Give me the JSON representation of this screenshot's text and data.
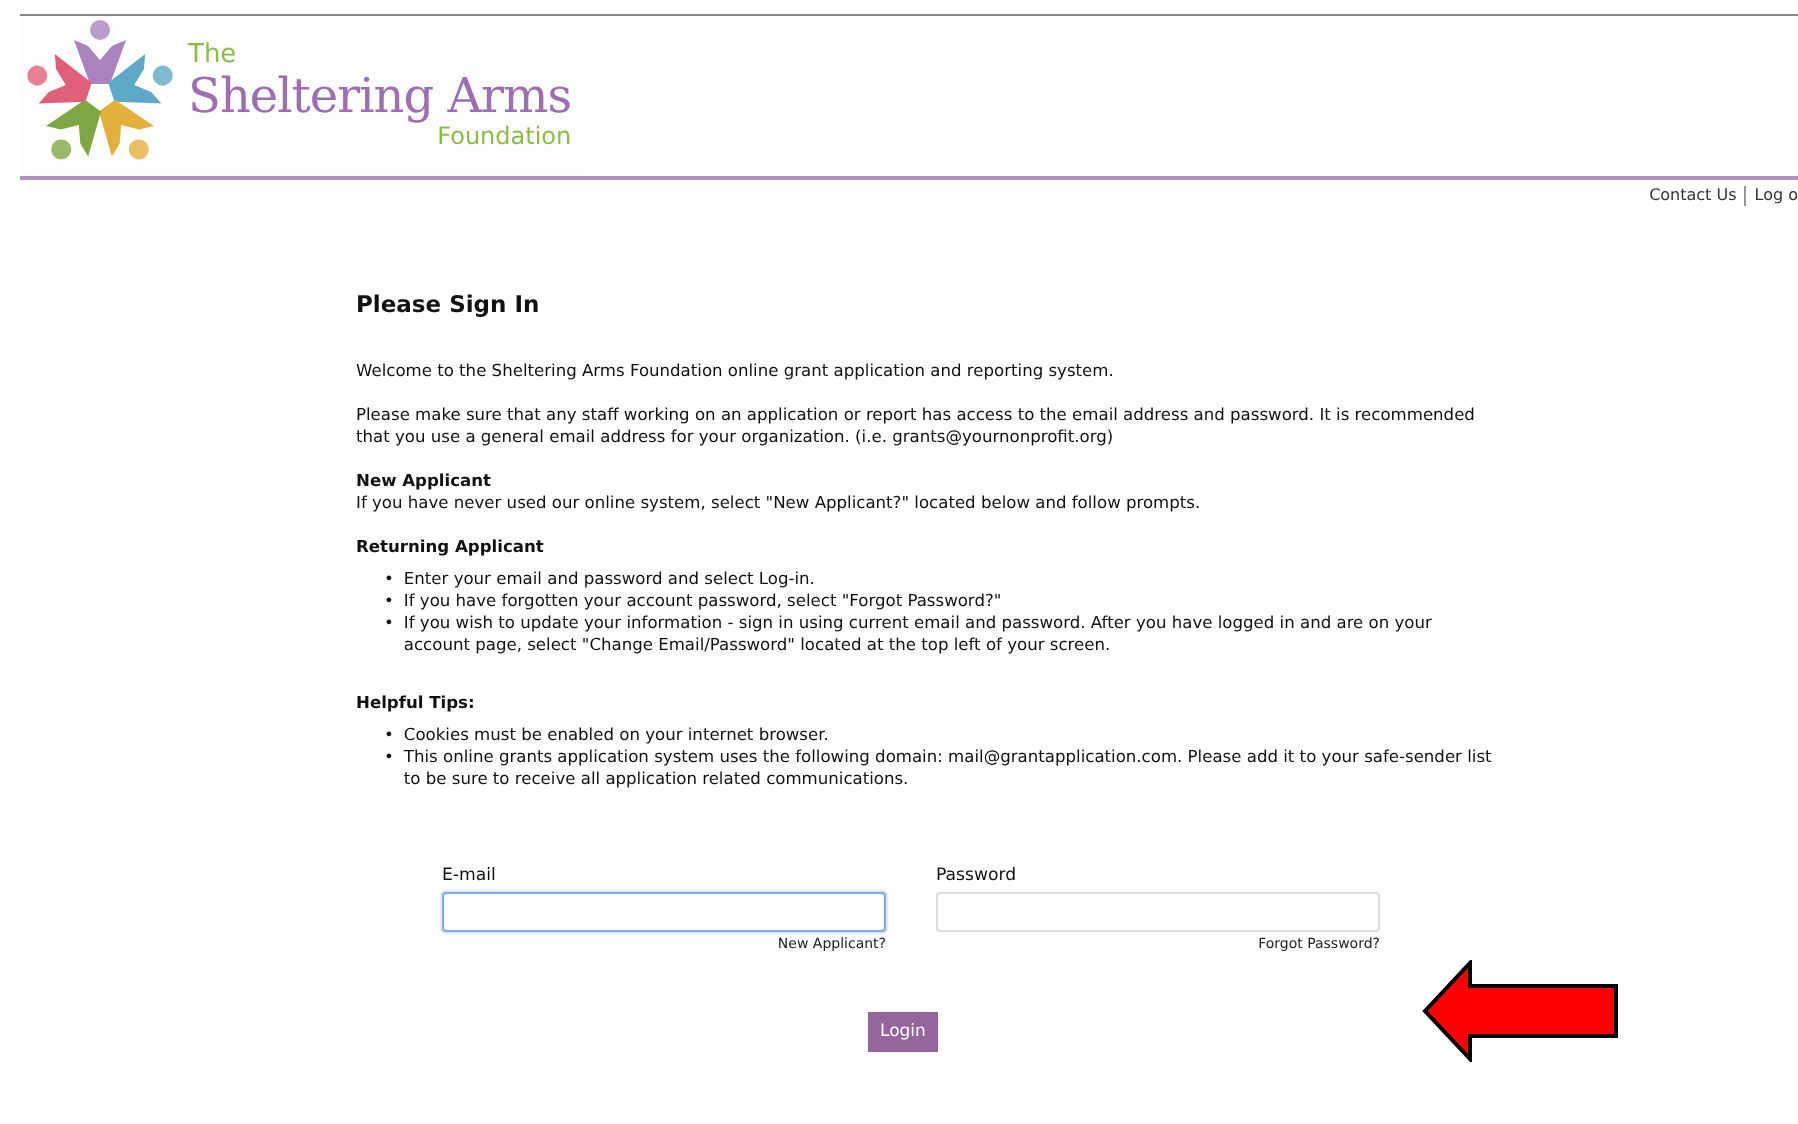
{
  "header": {
    "logo": {
      "small": "The",
      "main": "Sheltering Arms",
      "sub": "Foundation"
    },
    "links": [
      "Contact Us",
      "Log o"
    ]
  },
  "title": "Please Sign In",
  "intro": [
    "Welcome to the Sheltering Arms Foundation online grant application and reporting system.",
    "Please make sure that any staff working on an application or report has access to the email address and password. It is recommended that you use a general email address for your organization. (i.e. grants@yournonprofit.org)"
  ],
  "sections": [
    {
      "heading": "New Applicant",
      "text": "If you have never used our online system, select \"New Applicant?\" located below and follow prompts."
    },
    {
      "heading": "Returning Applicant",
      "marker": "•",
      "bullets": [
        "Enter your email and password and select Log-in.",
        "If you have forgotten your account password, select \"Forgot Password?\"",
        "If you wish to update your information - sign in using current email and password. After you have logged in and are on your account page, select \"Change Email/Password\" located at the top left of your screen."
      ]
    },
    {
      "heading": "Helpful Tips:",
      "marker": "•",
      "bullets": [
        "Cookies must be enabled on your internet browser.",
        "This online grants application system uses the following domain: mail@grantapplication.com. Please add it to your safe-sender list to be sure to receive all application related communications."
      ]
    }
  ],
  "form": {
    "fields": [
      {
        "label": "E-mail",
        "focused": true,
        "link": "New Applicant?"
      },
      {
        "label": "Password",
        "focused": false,
        "link": "Forgot Password?"
      }
    ],
    "button": "Login"
  }
}
